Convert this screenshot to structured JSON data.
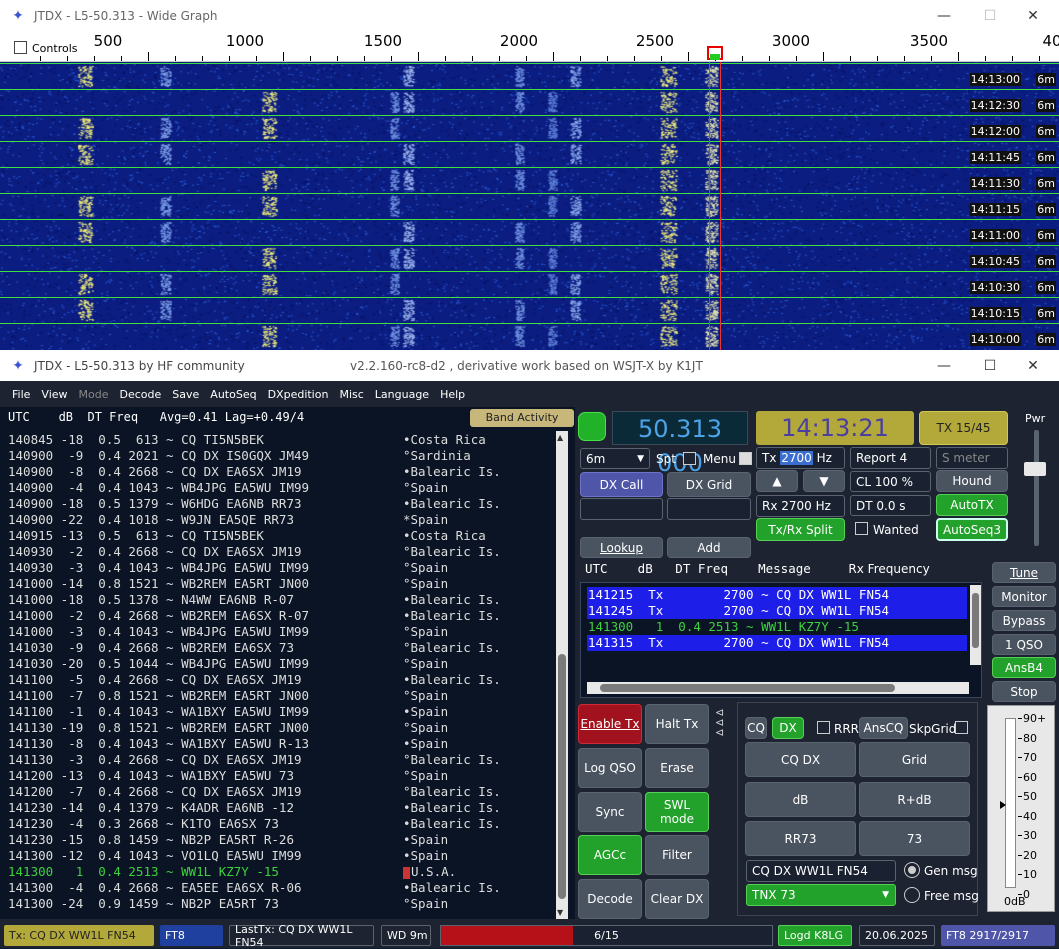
{
  "wide_graph": {
    "title": "JTDX - L5-50.313 - Wide Graph",
    "controls_label": "Controls",
    "scale_ticks": [
      "500",
      "1000",
      "1500",
      "2000",
      "2500",
      "3000",
      "3500",
      "40"
    ],
    "rows": [
      {
        "time": "14:13:00",
        "band": "6m"
      },
      {
        "time": "14:12:30",
        "band": "6m"
      },
      {
        "time": "14:12:00",
        "band": "6m"
      },
      {
        "time": "14:11:45",
        "band": "6m"
      },
      {
        "time": "14:11:30",
        "band": "6m"
      },
      {
        "time": "14:11:15",
        "band": "6m"
      },
      {
        "time": "14:11:00",
        "band": "6m"
      },
      {
        "time": "14:10:45",
        "band": "6m"
      },
      {
        "time": "14:10:30",
        "band": "6m"
      },
      {
        "time": "14:10:15",
        "band": "6m"
      },
      {
        "time": "14:10:00",
        "band": "6m"
      }
    ]
  },
  "main": {
    "title": "JTDX - L5-50.313  by HF community",
    "version": "v2.2.160-rc8-d2 , derivative work based on WSJT-X by K1JT",
    "menu": [
      "File",
      "View",
      "Mode",
      "Decode",
      "Save",
      "AutoSeq",
      "DXpedition",
      "Misc",
      "Language",
      "Help"
    ],
    "left_header": "UTC    dB  DT Freq   Avg=0.41 Lag=+0.49/4",
    "band_activity": "Band Activity",
    "decodes": [
      {
        "t": "140845 -18  0.5  613 ~ CQ TI5N5BEK",
        "c": "•Costa Rica"
      },
      {
        "t": "140900  -9  0.4 2021 ~ CQ DX IS0GQX JM49",
        "c": "°Sardinia"
      },
      {
        "t": "140900  -8  0.4 2668 ~ CQ DX EA6SX JM19",
        "c": "•Balearic Is."
      },
      {
        "t": "140900  -4  0.4 1043 ~ WB4JPG EA5WU IM99",
        "c": "°Spain"
      },
      {
        "t": "140900 -18  0.5 1379 ~ W6HDG EA6NB RR73",
        "c": "•Balearic Is."
      },
      {
        "t": "140900 -22  0.4 1018 ~ W9JN EA5QE RR73",
        "c": "*Spain"
      },
      {
        "t": "140915 -13  0.5  613 ~ CQ TI5N5BEK",
        "c": "•Costa Rica"
      },
      {
        "t": "140930  -2  0.4 2668 ~ CQ DX EA6SX JM19",
        "c": "°Balearic Is."
      },
      {
        "t": "140930  -3  0.4 1043 ~ WB4JPG EA5WU IM99",
        "c": "°Spain"
      },
      {
        "t": "141000 -14  0.8 1521 ~ WB2REM EA5RT JN00",
        "c": "°Spain"
      },
      {
        "t": "141000 -18  0.5 1378 ~ N4WW EA6NB R-07",
        "c": "•Balearic Is."
      },
      {
        "t": "141000  -2  0.4 2668 ~ WB2REM EA6SX R-07",
        "c": "•Balearic Is."
      },
      {
        "t": "141000  -3  0.4 1043 ~ WB4JPG EA5WU IM99",
        "c": "°Spain"
      },
      {
        "t": "141030  -9  0.4 2668 ~ WB2REM EA6SX 73",
        "c": "°Balearic Is."
      },
      {
        "t": "141030 -20  0.5 1044 ~ WB4JPG EA5WU IM99",
        "c": "°Spain"
      },
      {
        "t": "141100  -5  0.4 2668 ~ CQ DX EA6SX JM19",
        "c": "•Balearic Is."
      },
      {
        "t": "141100  -7  0.8 1521 ~ WB2REM EA5RT JN00",
        "c": "°Spain"
      },
      {
        "t": "141100  -1  0.4 1043 ~ WA1BXY EA5WU IM99",
        "c": "•Spain"
      },
      {
        "t": "141130 -19  0.8 1521 ~ WB2REM EA5RT JN00",
        "c": "°Spain"
      },
      {
        "t": "141130  -8  0.4 1043 ~ WA1BXY EA5WU R-13",
        "c": "•Spain"
      },
      {
        "t": "141130  -3  0.4 2668 ~ CQ DX EA6SX JM19",
        "c": "°Balearic Is."
      },
      {
        "t": "141200 -13  0.4 1043 ~ WA1BXY EA5WU 73",
        "c": "°Spain"
      },
      {
        "t": "141200  -7  0.4 2668 ~ CQ DX EA6SX JM19",
        "c": "°Balearic Is."
      },
      {
        "t": "141230 -14  0.4 1379 ~ K4ADR EA6NB -12",
        "c": "•Balearic Is."
      },
      {
        "t": "141230  -4  0.3 2668 ~ K1TO EA6SX 73",
        "c": "•Balearic Is."
      },
      {
        "t": "141230 -15  0.8 1459 ~ NB2P EA5RT R-26",
        "c": "•Spain"
      },
      {
        "t": "141300 -12  0.4 1043 ~ VO1LQ EA5WU IM99",
        "c": "•Spain"
      },
      {
        "t": "141300   1  0.4 2513 ~ WW1L KZ7Y -15",
        "c": "U.S.A.",
        "me": true
      },
      {
        "t": "141300  -4  0.4 2668 ~ EA5EE EA6SX R-06",
        "c": "•Balearic Is."
      },
      {
        "t": "141300 -24  0.9 1459 ~ NB2P EA5RT 73",
        "c": "°Spain"
      }
    ],
    "freq": "50.313 000",
    "clock": "14:13:21",
    "tx_period": "TX 15/45",
    "pwr_label": "Pwr",
    "band": "6m",
    "spt_label": "Spt",
    "menu_label": "Menu",
    "tx_label": "Tx",
    "tx_freq": "2700",
    "hz": "Hz",
    "report": "Report 4",
    "smeter": "S meter",
    "dx_call_btn": "DX Call",
    "dx_grid_btn": "DX Grid",
    "cl_label": "CL  100 %",
    "hound": "Hound",
    "rx_label": "Rx  2700  Hz",
    "dt_label": "DT 0.0 s",
    "autotx": "AutoTX",
    "txrx_split": "Tx/Rx Split",
    "wanted": "Wanted",
    "autoseq3": "AutoSeq3",
    "lookup": "Lookup",
    "add": "Add",
    "tune": "Tune",
    "monitor": "Monitor",
    "bypass": "Bypass",
    "qso1": "1 QSO",
    "ansb4": "AnsB4",
    "stop": "Stop",
    "rx_header": "UTC    dB   DT Freq    Message",
    "rx_header_rf": "Rx Frequency",
    "rx_rows": [
      {
        "t": "141215  Tx        2700 ~ CQ DX WW1L FN54",
        "k": "tx"
      },
      {
        "t": "141245  Tx        2700 ~ CQ DX WW1L FN54",
        "k": "tx"
      },
      {
        "t": "141300   1  0.4 2513 ~ WW1L KZ7Y -15",
        "k": "rx"
      },
      {
        "t": "141315  Tx        2700 ~ CQ DX WW1L FN54",
        "k": "tx"
      }
    ],
    "enable_tx": "Enable Tx",
    "halt_tx": "Halt Tx",
    "log_qso": "Log QSO",
    "erase": "Erase",
    "sync": "Sync",
    "swl_mode": "SWL mode",
    "agcc": "AGCc",
    "filter": "Filter",
    "decode": "Decode",
    "clear_dx": "Clear DX",
    "cq": "CQ",
    "dx": "DX",
    "rrr": "RRR",
    "anscq": "AnsCQ",
    "skpgrid": "SkpGrid",
    "cq_dx": "CQ DX",
    "grid": "Grid",
    "db": "dB",
    "rdb": "R+dB",
    "rr73": "RR73",
    "s73": "73",
    "gen_field": "CQ DX WW1L FN54",
    "gen_msg": "Gen msg",
    "tnx": "TNX 73",
    "free_msg": "Free msg",
    "meter_ticks": [
      "90+",
      "80",
      "70",
      "60",
      "50",
      "40",
      "30",
      "20",
      "10",
      "0"
    ],
    "meter_zero": "0dB",
    "status": {
      "tx": "Tx: CQ DX WW1L FN54",
      "mode": "FT8",
      "last_tx": "LastTx: CQ DX WW1L FN54",
      "wd": "WD 9m",
      "progress_text": "6/15",
      "progress": 0.4,
      "logd": "Logd K8LG",
      "date": "20.06.2025",
      "counter": "FT8  2917/2917"
    }
  },
  "colors": {
    "accent_green": "#22a22a",
    "accent_red": "#a1121e",
    "accent_blue": "#4f55a8",
    "olive": "#b3a93a"
  }
}
